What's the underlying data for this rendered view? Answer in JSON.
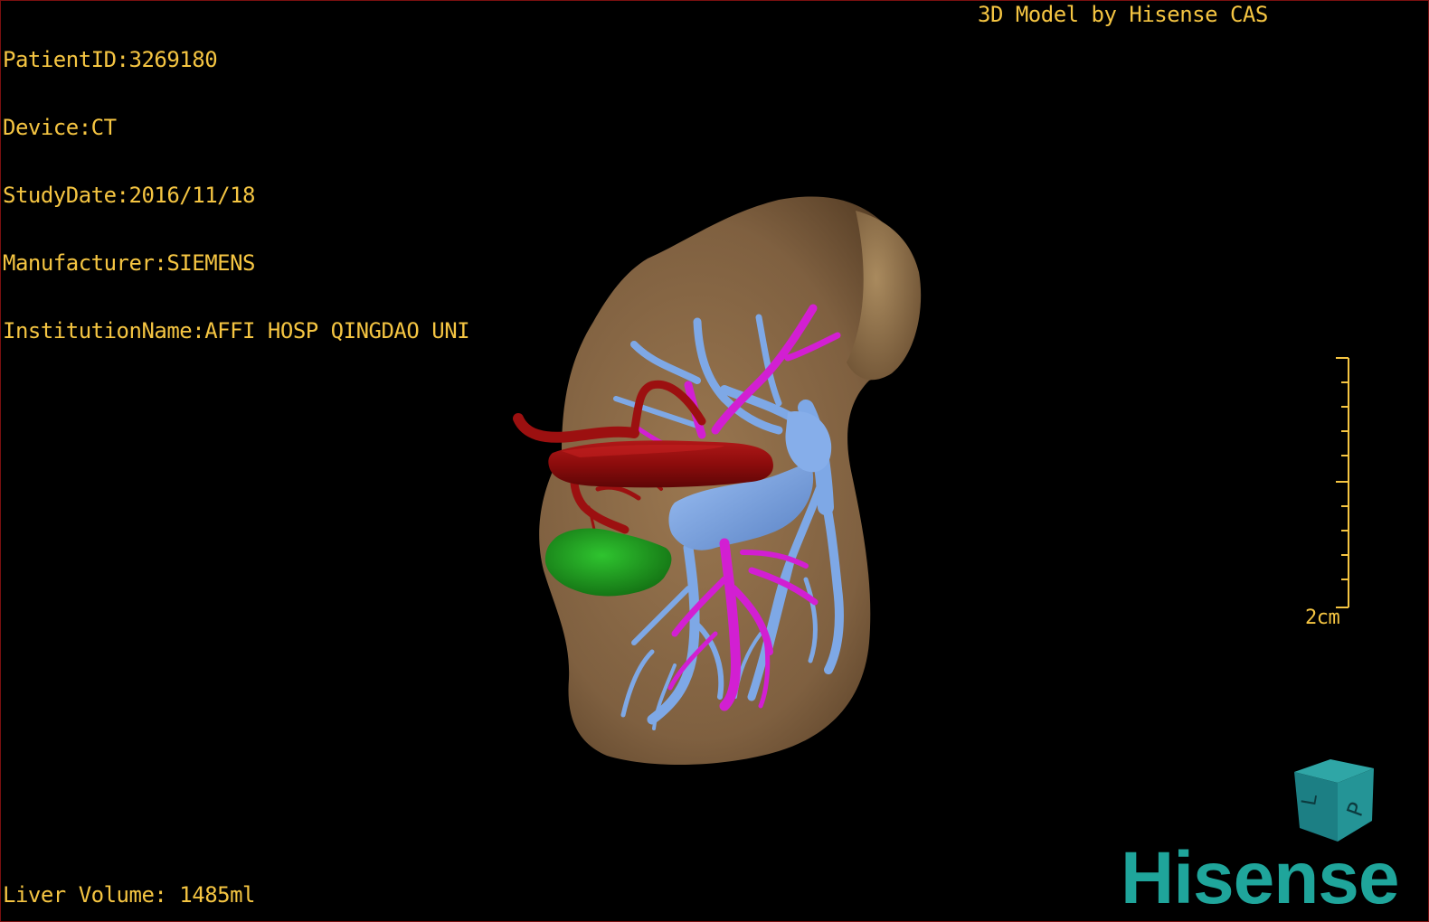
{
  "patient": {
    "id_line": "PatientID:3269180",
    "device_line": "Device:CT",
    "study_date_line": "StudyDate:2016/11/18",
    "manufacturer_line": "Manufacturer:SIEMENS",
    "institution_line": "InstitutionName:AFFI HOSP QINGDAO UNI"
  },
  "header": {
    "title": "3D Model by Hisense CAS"
  },
  "footer": {
    "volume_text": "Liver Volume: 1485ml"
  },
  "scale": {
    "label": "2cm"
  },
  "orientation_cube": {
    "face_front": "L",
    "face_side": "P"
  },
  "brand": {
    "name": "Hisense"
  },
  "colors": {
    "overlay_text": "#f5c542",
    "liver": "#8a6a45",
    "artery": "#a01010",
    "portal_vein": "#7ea8e6",
    "hepatic_vein": "#d21fd2",
    "lesion": "#1e9a1e",
    "brand": "#1fa59b",
    "frame_border": "#7a1010"
  }
}
